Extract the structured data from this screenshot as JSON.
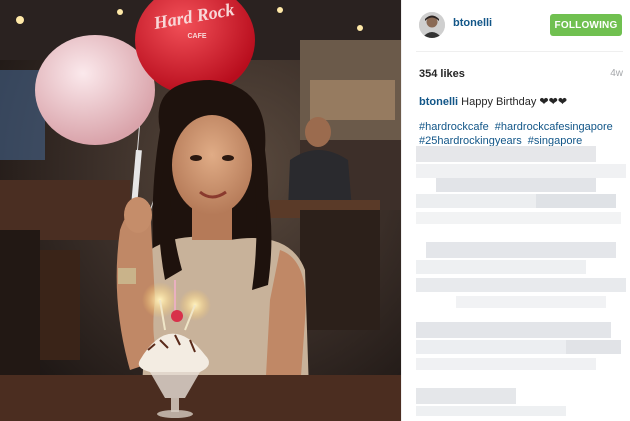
{
  "post": {
    "username": "btonelli",
    "follow_label": "FOLLOWING",
    "likes": "354 likes",
    "time_ago": "4w",
    "caption_user": "btonelli",
    "caption_text": "Happy Birthday ❤❤❤",
    "hashtags": [
      "#hardrockcafe",
      "#hardrockcafesingapore",
      "#25hardrockingyears",
      "#singapore"
    ]
  },
  "photo": {
    "balloon_text": "Hard Rock",
    "balloon_subtext": "CAFE"
  },
  "colors": {
    "follow_bg": "#70c050",
    "link": "#125688",
    "muted": "#a5a7aa"
  }
}
